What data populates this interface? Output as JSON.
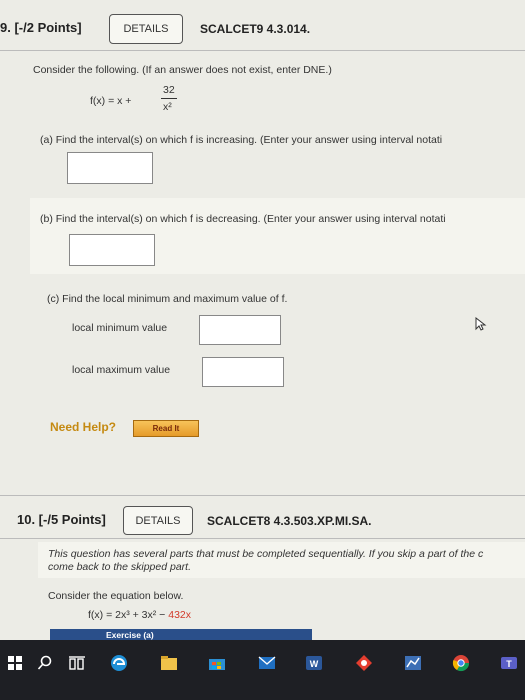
{
  "q9": {
    "number": "9. [-/2 Points]",
    "details": "DETAILS",
    "code": "SCALCET9 4.3.014.",
    "intro": "Consider the following. (If an answer does not exist, enter DNE.)",
    "func_lhs": "f(x) = x +",
    "func_num": "32",
    "func_den": "x²",
    "part_a": "(a)  Find the interval(s) on which f is increasing. (Enter your answer using interval notati",
    "part_b": "(b)  Find the interval(s) on which f is decreasing. (Enter your answer using interval notati",
    "part_c": "(c)  Find the local minimum and maximum value of f.",
    "local_min_label": "local minimum value",
    "local_max_label": "local maximum value",
    "need_help": "Need Help?",
    "read_it": "Read It"
  },
  "q10": {
    "number": "10. [-/5 Points]",
    "details": "DETAILS",
    "code": "SCALCET8 4.3.503.XP.MI.SA.",
    "note_line1": "This question has several parts that must be completed sequentially. If you skip a part of the c",
    "note_line2": "come back to the skipped part.",
    "consider": "Consider the equation below.",
    "func_main": "f(x) = 2x³ + 3x² − ",
    "func_tail": "432x",
    "exercise": "Exercise (a)"
  },
  "colors": {
    "accent_red": "#d23a2a",
    "need_help": "#c58a12",
    "exercise_bar": "#2a4f8a"
  }
}
